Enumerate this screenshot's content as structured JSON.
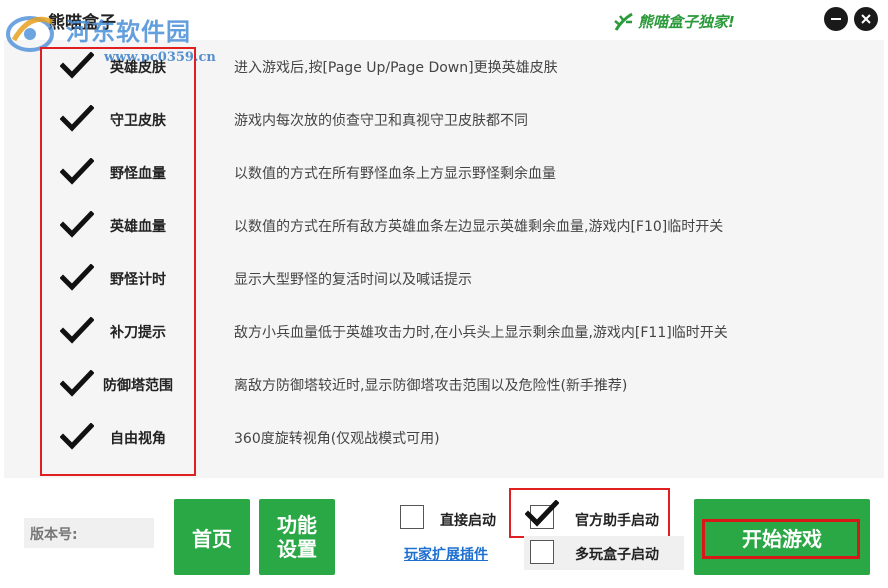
{
  "window": {
    "title": "熊喵盒子",
    "minimize_label": "−",
    "close_label": "✕"
  },
  "watermark": {
    "site_name": "河东软件园",
    "url": "www.pc0359.cn"
  },
  "exclusive_badge": {
    "text": "熊喵盒子独家!",
    "icon": "bamboo-icon",
    "color": "#2a9a3a"
  },
  "features": [
    {
      "label": "英雄皮肤",
      "checked": true,
      "description": "进入游戏后,按[Page Up/Page Down]更换英雄皮肤"
    },
    {
      "label": "守卫皮肤",
      "checked": true,
      "description": "游戏内每次放的侦查守卫和真视守卫皮肤都不同"
    },
    {
      "label": "野怪血量",
      "checked": true,
      "description": "以数值的方式在所有野怪血条上方显示野怪剩余血量"
    },
    {
      "label": "英雄血量",
      "checked": true,
      "description": "以数值的方式在所有敌方英雄血条左边显示英雄剩余血量,游戏内[F10]临时开关"
    },
    {
      "label": "野怪计时",
      "checked": true,
      "description": "显示大型野怪的复活时间以及喊话提示"
    },
    {
      "label": "补刀提示",
      "checked": true,
      "description": "敌方小兵血量低于英雄攻击力时,在小兵头上显示剩余血量,游戏内[F11]临时开关"
    },
    {
      "label": "防御塔范围",
      "checked": true,
      "description": "离敌方防御塔较近时,显示防御塔攻击范围以及危险性(新手推荐)"
    },
    {
      "label": "自由视角",
      "checked": true,
      "description": "360度旋转视角(仅观战模式可用)"
    }
  ],
  "bottom": {
    "version_label": "版本号:",
    "home_button": "首页",
    "func_button_line1": "功能",
    "func_button_line2": "设置",
    "direct_launch": {
      "label": "直接启动",
      "checked": false
    },
    "official_launch": {
      "label": "官方助手启动",
      "checked": true
    },
    "multi_launch": {
      "label": "多玩盒子启动",
      "checked": false
    },
    "plugin_link": "玩家扩展插件",
    "start_button": "开始游戏"
  },
  "colors": {
    "accent_green": "#2aa845",
    "highlight_red": "#e02020",
    "link_blue": "#1e6fd0"
  }
}
